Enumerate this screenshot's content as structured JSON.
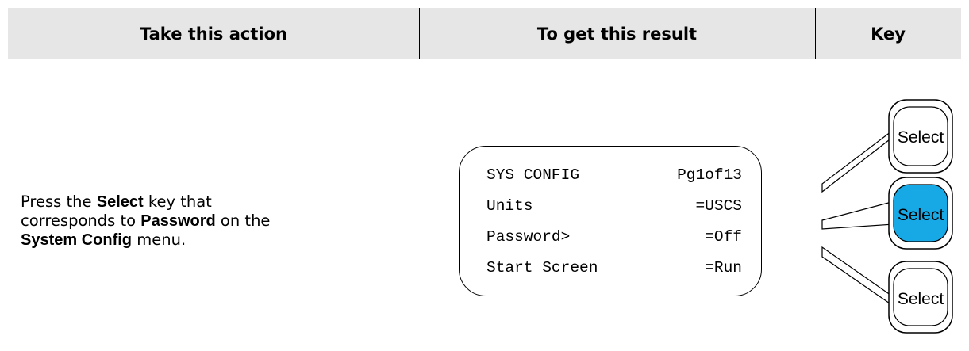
{
  "header": {
    "action": "Take this action",
    "result": "To get this result",
    "key": "Key"
  },
  "instruction": {
    "p1": "Press the ",
    "select": "Select",
    "p2": " key that corresponds to ",
    "password": "Password",
    "p3": " on the ",
    "menu": "System Config",
    "p4": " menu."
  },
  "display": {
    "lines": [
      {
        "left": "SYS CONFIG",
        "right": "Pg1of13"
      },
      {
        "left": "Units",
        "right": "=USCS"
      },
      {
        "left": "Password>",
        "right": "=Off"
      },
      {
        "left": "Start Screen",
        "right": "=Run"
      }
    ]
  },
  "keys": [
    {
      "label": "Select",
      "highlighted": false
    },
    {
      "label": "Select",
      "highlighted": true
    },
    {
      "label": "Select",
      "highlighted": false
    }
  ],
  "colors": {
    "header_bg": "#e6e6e6",
    "highlight": "#17a9e6"
  }
}
